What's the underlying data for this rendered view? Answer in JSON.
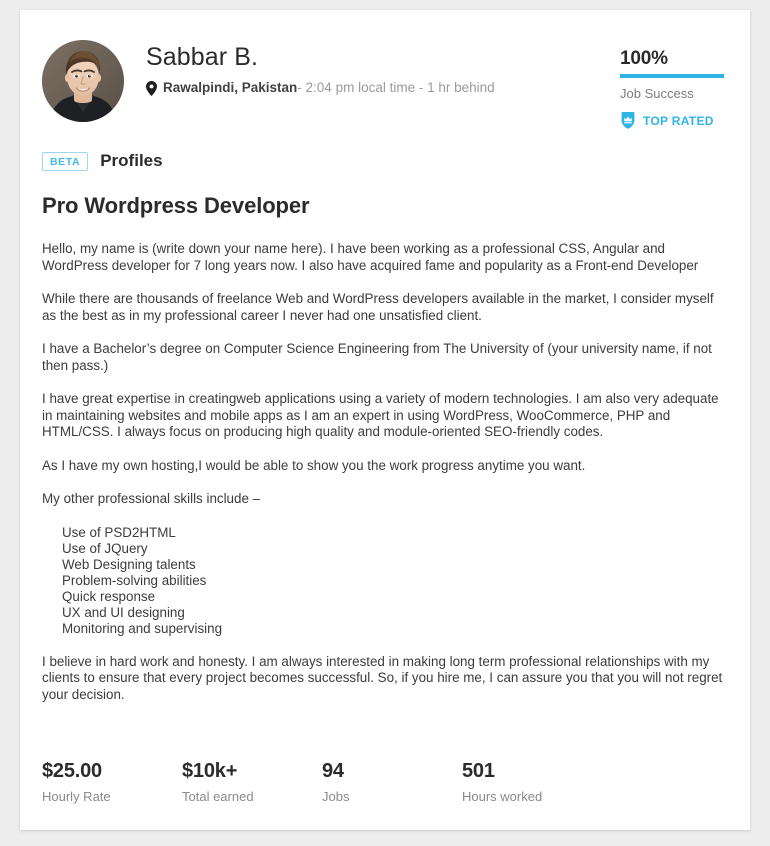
{
  "profile": {
    "name": "Sabbar B.",
    "avatar_icon": "user-photo",
    "location_icon": "location-pin-icon",
    "location": "Rawalpindi, Pakistan",
    "time_info": " - 2:04 pm local time - 1 hr behind"
  },
  "job_success": {
    "percent": "100%",
    "percent_value": 100,
    "label": "Job Success",
    "badge_icon": "top-rated-badge-icon",
    "badge_label": "TOP RATED",
    "accent_color": "#2fb4e4"
  },
  "profiles_section": {
    "beta_label": "BETA",
    "label": "Profiles",
    "beta_color": "#3fbbe6"
  },
  "profile_content": {
    "title": "Pro Wordpress Developer",
    "paragraphs": [
      "Hello, my name is (write down your name here). I have been working as a professional CSS, Angular and WordPress developer for 7 long years now. I also have acquired fame and popularity as a Front-end Developer",
      "While there are thousands of freelance Web and WordPress developers available in the market, I consider myself as the best as in my professional career I never had one unsatisfied client.",
      "I have a Bachelor’s degree on Computer Science Engineering from The University of (your university name, if not then pass.)",
      "I have great expertise in creatingweb applications using a variety of modern technologies. I am also very adequate in maintaining websites and mobile apps as I am an expert in using WordPress, WooCommerce, PHP and HTML/CSS. I always focus on producing high quality and module-oriented SEO-friendly codes.",
      "As I have my own hosting,I would be able to show you the work progress anytime you want.",
      "My other professional skills include –"
    ],
    "skills": [
      "Use of PSD2HTML",
      "Use of JQuery",
      "Web Designing talents",
      "Problem-solving abilities",
      "Quick response",
      "UX and UI designing",
      "Monitoring and supervising"
    ],
    "closing_paragraph": "I believe in hard work and honesty. I am always interested in making long term professional relationships with my clients to ensure that every project becomes successful. So, if you hire me, I can assure you that you will not regret your decision."
  },
  "stats": [
    {
      "value": "$25.00",
      "label": "Hourly Rate"
    },
    {
      "value": "$10k+",
      "label": "Total earned"
    },
    {
      "value": "94",
      "label": "Jobs"
    },
    {
      "value": "501",
      "label": "Hours worked"
    }
  ]
}
